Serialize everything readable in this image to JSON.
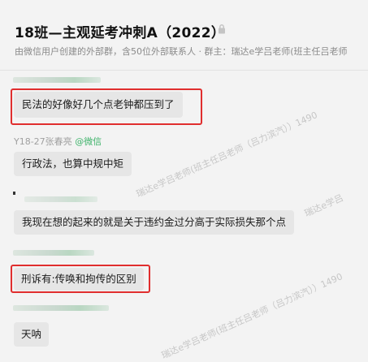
{
  "header": {
    "title": "18班—主观延考冲刺A（2022）",
    "subtitle": "由微信用户创建的外部群，含50位外部联系人 · 群主：瑞达e学吕老师(班主任吕老师"
  },
  "icons": {
    "lock": "lock-icon"
  },
  "messages": [
    {
      "text": "民法的好像好几个点老钟都压到了",
      "highlighted": true
    },
    {
      "sender": "Y18-27张春亮",
      "sender_source": "@微信",
      "text": "行政法，也算中规中矩"
    },
    {
      "text": "我现在想的起来的就是关于违约金过分高于实际损失那个点"
    },
    {
      "text": "刑诉有:传唤和拘传的区别",
      "highlighted": true
    },
    {
      "text": "天呐"
    }
  ],
  "watermarks": [
    "瑞达e学吕老师(班主任吕老师（吕力滨汽））1490",
    "瑞达e学吕",
    "瑞达e学吕老师(班主任吕老师（吕力滨汽））1490"
  ],
  "colors": {
    "background": "#f3f3f3",
    "bubble": "#e6e6e6",
    "highlight_border": "#e02e2e",
    "wechat_green": "#3fb36b"
  }
}
